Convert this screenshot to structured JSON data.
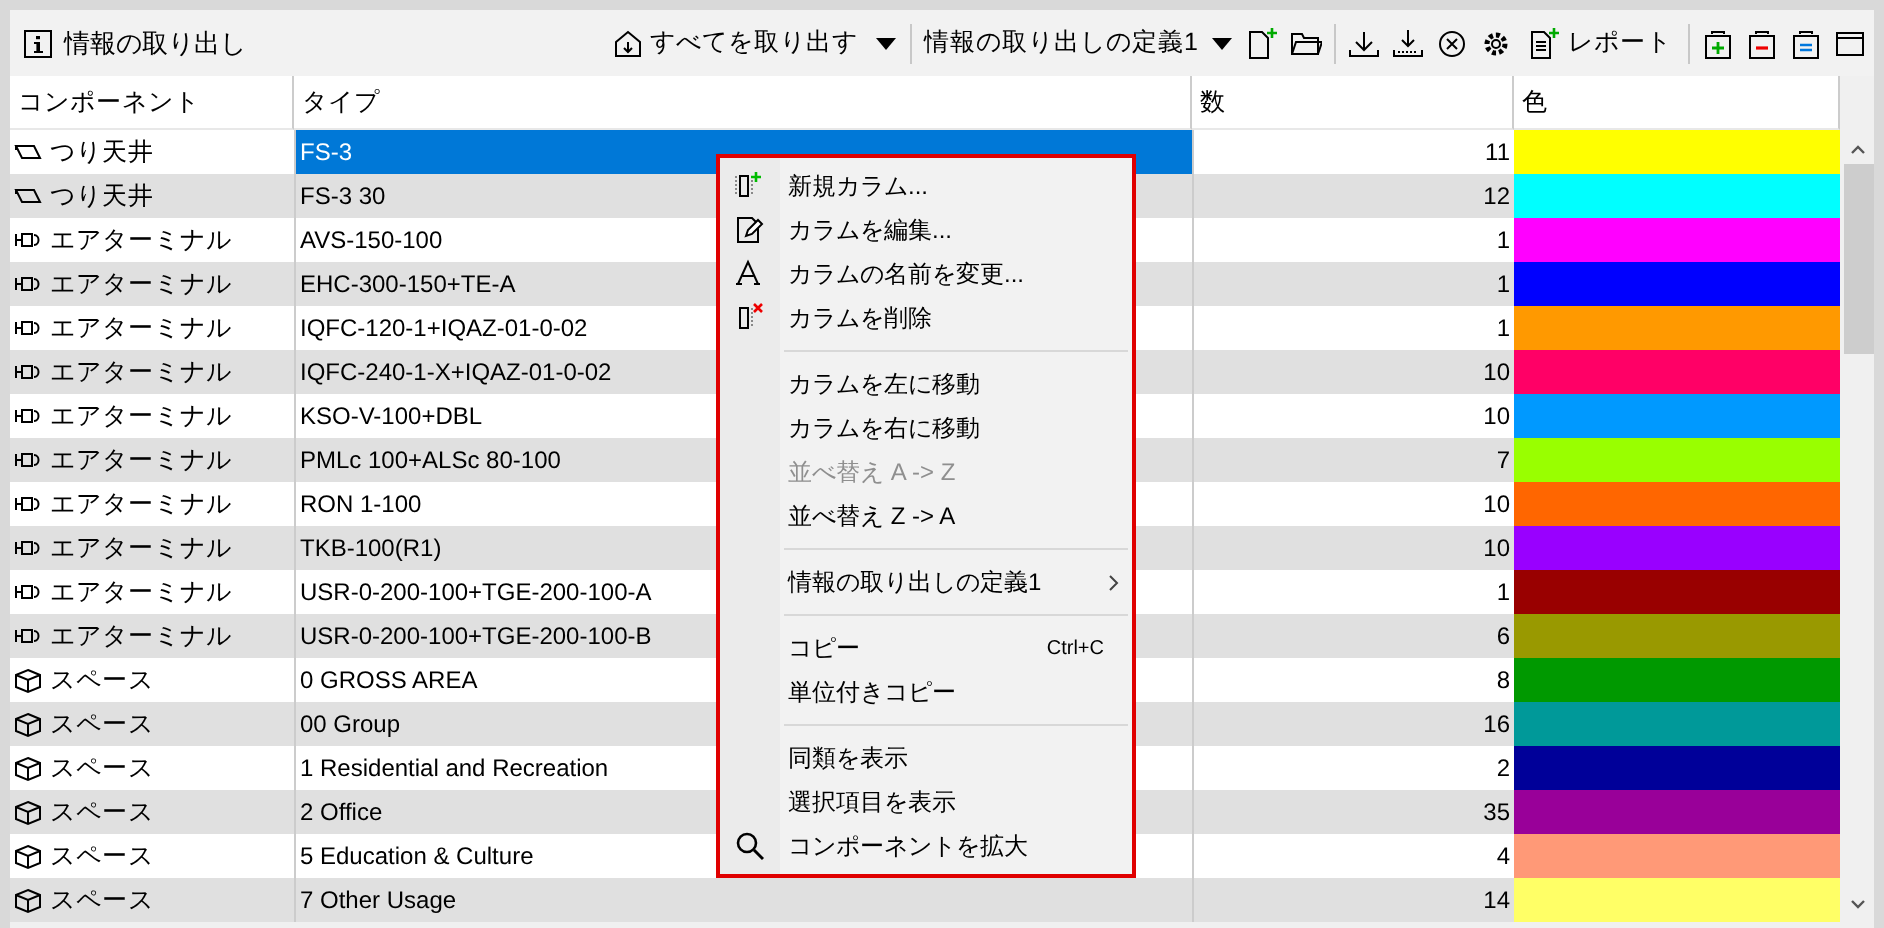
{
  "toolbar": {
    "title": "情報の取り出し",
    "extract_all": "すべてを取り出す",
    "definition": "情報の取り出しの定義1",
    "report": "レポート"
  },
  "table": {
    "columns": [
      "コンポーネント",
      "タイプ",
      "数",
      "色"
    ],
    "rows": [
      {
        "kind": "ceiling",
        "component": "つり天井",
        "type": "FS-3",
        "count": "11",
        "color": "#ffff00",
        "selected": true
      },
      {
        "kind": "ceiling",
        "component": "つり天井",
        "type": "FS-3 30",
        "count": "12",
        "color": "#00ffff",
        "selected": false
      },
      {
        "kind": "terminal",
        "component": "エアターミナル",
        "type": "AVS-150-100",
        "count": "1",
        "color": "#ff00ff",
        "selected": false
      },
      {
        "kind": "terminal",
        "component": "エアターミナル",
        "type": "EHC-300-150+TE-A",
        "count": "1",
        "color": "#0000ff",
        "selected": false
      },
      {
        "kind": "terminal",
        "component": "エアターミナル",
        "type": "IQFC-120-1+IQAZ-01-0-02",
        "count": "1",
        "color": "#ff9900",
        "selected": false
      },
      {
        "kind": "terminal",
        "component": "エアターミナル",
        "type": "IQFC-240-1-X+IQAZ-01-0-02",
        "count": "10",
        "color": "#ff0066",
        "selected": false
      },
      {
        "kind": "terminal",
        "component": "エアターミナル",
        "type": "KSO-V-100+DBL",
        "count": "10",
        "color": "#0099ff",
        "selected": false
      },
      {
        "kind": "terminal",
        "component": "エアターミナル",
        "type": "PMLc 100+ALSc 80-100",
        "count": "7",
        "color": "#99ff00",
        "selected": false
      },
      {
        "kind": "terminal",
        "component": "エアターミナル",
        "type": "RON 1-100",
        "count": "10",
        "color": "#ff6600",
        "selected": false
      },
      {
        "kind": "terminal",
        "component": "エアターミナル",
        "type": "TKB-100(R1)",
        "count": "10",
        "color": "#9900ff",
        "selected": false
      },
      {
        "kind": "terminal",
        "component": "エアターミナル",
        "type": "USR-0-200-100+TGE-200-100-A",
        "count": "1",
        "color": "#990000",
        "selected": false
      },
      {
        "kind": "terminal",
        "component": "エアターミナル",
        "type": "USR-0-200-100+TGE-200-100-B",
        "count": "6",
        "color": "#999900",
        "selected": false
      },
      {
        "kind": "space",
        "component": "スペース",
        "type": "0 GROSS AREA",
        "count": "8",
        "color": "#009900",
        "selected": false
      },
      {
        "kind": "space",
        "component": "スペース",
        "type": "00 Group",
        "count": "16",
        "color": "#009999",
        "selected": false
      },
      {
        "kind": "space",
        "component": "スペース",
        "type": "1 Residential and Recreation",
        "count": "2",
        "color": "#000099",
        "selected": false
      },
      {
        "kind": "space",
        "component": "スペース",
        "type": "2 Office",
        "count": "35",
        "color": "#990099",
        "selected": false
      },
      {
        "kind": "space",
        "component": "スペース",
        "type": "5 Education & Culture",
        "count": "4",
        "color": "#ff9977",
        "selected": false
      },
      {
        "kind": "space",
        "component": "スペース",
        "type": "7 Other Usage",
        "count": "14",
        "color": "#ffff66",
        "selected": false
      }
    ]
  },
  "context_menu": {
    "groups": [
      [
        {
          "label": "新規カラム...",
          "disabled": false
        },
        {
          "label": "カラムを編集...",
          "disabled": false
        },
        {
          "label": "カラムの名前を変更...",
          "disabled": false
        },
        {
          "label": "カラムを削除",
          "disabled": false
        }
      ],
      [
        {
          "label": "カラムを左に移動",
          "disabled": false
        },
        {
          "label": "カラムを右に移動",
          "disabled": false
        },
        {
          "label": "並べ替え A -> Z",
          "disabled": true
        },
        {
          "label": "並べ替え Z -> A",
          "disabled": false
        }
      ],
      [
        {
          "label": "情報の取り出しの定義1",
          "disabled": false,
          "submenu": true
        }
      ],
      [
        {
          "label": "コピー",
          "disabled": false,
          "shortcut": "Ctrl+C"
        },
        {
          "label": "単位付きコピー",
          "disabled": false
        }
      ],
      [
        {
          "label": "同類を表示",
          "disabled": false
        },
        {
          "label": "選択項目を表示",
          "disabled": false
        },
        {
          "label": "コンポーネントを拡大",
          "disabled": false
        }
      ]
    ]
  }
}
